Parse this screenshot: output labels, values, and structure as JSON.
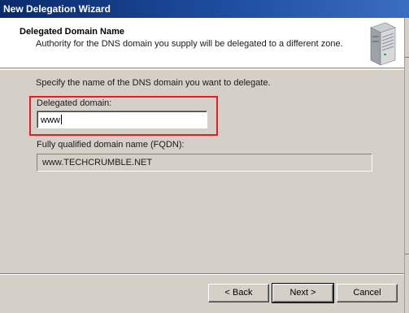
{
  "window": {
    "title": "New Delegation Wizard"
  },
  "header": {
    "title": "Delegated Domain Name",
    "subtitle": "Authority for the DNS domain you supply will be delegated to a different zone.",
    "icon": "server-icon"
  },
  "main": {
    "instruction": "Specify the name of the DNS domain you want to delegate.",
    "delegated_domain": {
      "label": "Delegated domain:",
      "value": "www"
    },
    "fqdn": {
      "label": "Fully qualified domain name (FQDN):",
      "value": "www.TECHCRUMBLE.NET"
    }
  },
  "buttons": {
    "back": "< Back",
    "next": "Next >",
    "cancel": "Cancel"
  },
  "colors": {
    "title_bar": "#0b2a6c",
    "highlight_border": "#e11f25",
    "dialog_bg": "#d4d0c8"
  }
}
